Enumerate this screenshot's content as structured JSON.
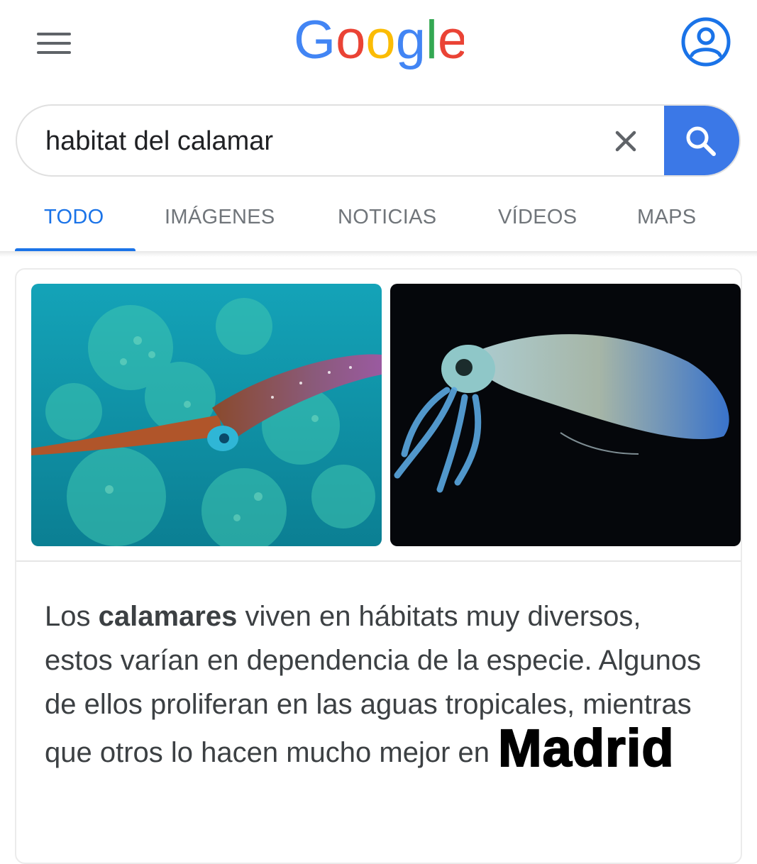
{
  "header": {
    "logo_text": "Google",
    "logo_colors": [
      "#4285F4",
      "#EA4335",
      "#FBBC05",
      "#4285F4",
      "#34A853",
      "#EA4335"
    ],
    "menu_icon": "hamburger-menu-icon",
    "account_icon": "account-circle-icon"
  },
  "search": {
    "value": "habitat del calamar",
    "clear_icon": "close-icon",
    "search_icon": "search-icon",
    "accent_color": "#3b78e7"
  },
  "tabs": [
    {
      "label": "TODO",
      "active": true
    },
    {
      "label": "IMÁGENES",
      "active": false
    },
    {
      "label": "NOTICIAS",
      "active": false
    },
    {
      "label": "VÍDEOS",
      "active": false
    },
    {
      "label": "MAPS",
      "active": false
    }
  ],
  "result": {
    "images": [
      "squid-in-reef-photo",
      "squid-on-black-photo"
    ],
    "snippet_pre": "Los ",
    "snippet_bold": "calamares",
    "snippet_post": " viven en hábitats muy diversos, estos varían en dependencia de la especie. Algunos de ellos proliferan en las aguas tropicales, mientras que otros lo hacen mucho mejor en",
    "snippet_highlight": "Madrid"
  }
}
